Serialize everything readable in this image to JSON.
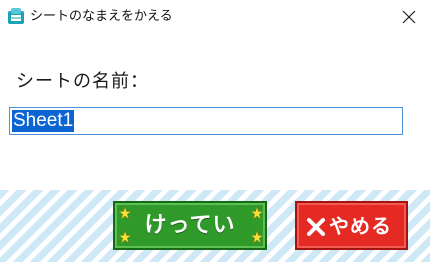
{
  "window": {
    "title": "シートのなまえをかえる",
    "icon": "app-icon"
  },
  "form": {
    "label": "シートの名前：",
    "input_value": "Sheet1",
    "input_selected": true
  },
  "buttons": {
    "ok_label": "けってい",
    "cancel_label": "やめる"
  },
  "colors": {
    "ok_bg": "#2f9a2a",
    "cancel_bg": "#e52a24",
    "selection": "#0a64d2",
    "input_border": "#4d8fd8",
    "stripe": "#cfe8f5"
  },
  "icons": [
    "app-icon",
    "close-icon",
    "star-icon",
    "x-icon"
  ]
}
